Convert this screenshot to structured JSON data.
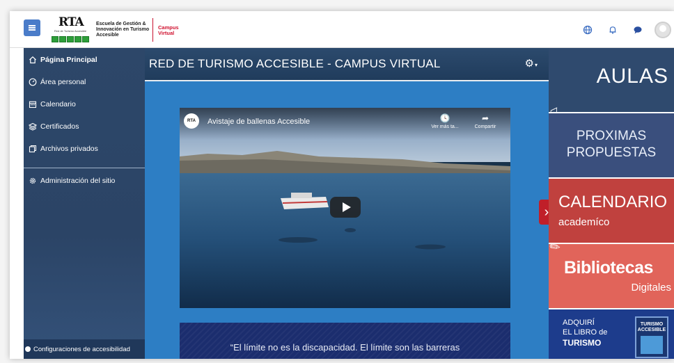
{
  "header": {
    "logo_text": "RTA",
    "logo_subtext": "Red de Turismo Accesible",
    "school_name": "Escuela de Gestión & Innovación en Turismo Accesible",
    "campus_label": "Campus Virtual",
    "icons": [
      "globe-icon",
      "bell-icon",
      "chat-icon"
    ]
  },
  "sidebar": {
    "items": [
      {
        "label": "Página Principal",
        "icon": "home-icon"
      },
      {
        "label": "Área personal",
        "icon": "dashboard-icon"
      },
      {
        "label": "Calendario",
        "icon": "calendar-icon"
      },
      {
        "label": "Certificados",
        "icon": "layers-icon"
      },
      {
        "label": "Archivos privados",
        "icon": "files-icon"
      },
      {
        "label": "Administración del sitio",
        "icon": "gear-icon"
      }
    ],
    "bottom_label": "Configuraciones de accesibilidad"
  },
  "main": {
    "title": "RED DE TURISMO ACCESIBLE - CAMPUS VIRTUAL",
    "video": {
      "channel_logo": "RTA",
      "title": "Avistaje de ballenas Accesible",
      "watch_later": "Ver más ta...",
      "share": "Compartir"
    },
    "quote": "“El límite no es la discapacidad. El límite son las barreras"
  },
  "right_panel": {
    "aulas": "AULAS",
    "proximas_1": "PROXIMAS",
    "proximas_2": "PROPUESTAS",
    "calendario_1": "CALENDARIO",
    "calendario_2": "academíco",
    "bibliotecas_1": "Bibliotecas",
    "bibliotecas_2": "Digitales",
    "libro_1": "ADQUIRÍ",
    "libro_2": "EL LIBRO de",
    "libro_3": "TURISMO",
    "book_title": "TURISMO ACCESIBLE"
  },
  "colors": {
    "sidebar": "#2d4769",
    "main_bg": "#2d7ec4",
    "accent_red": "#c01f29",
    "aulas": "#2f4a6e",
    "calendario": "#c0413e",
    "bibliotecas": "#e1645a"
  }
}
